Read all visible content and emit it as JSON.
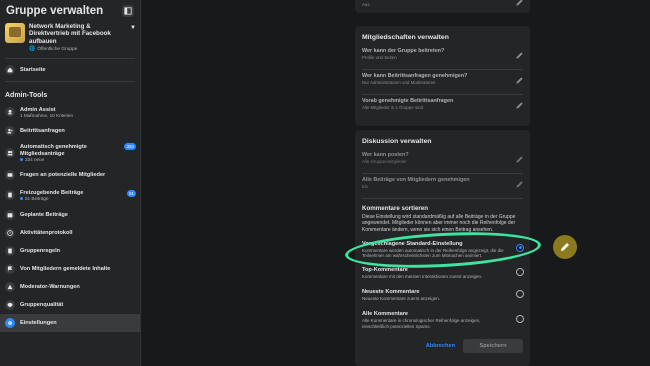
{
  "sidebar": {
    "title": "Gruppe verwalten",
    "group": {
      "name": "Network Marketing & Direktvertrieb mit Facebook aufbauen",
      "type": "Öffentliche Gruppe"
    },
    "home_label": "Startseite",
    "admin_tools_title": "Admin-Tools",
    "items": [
      {
        "label": "Admin Assist",
        "sub": "1 Maßnahme, 10 Kriterien"
      },
      {
        "label": "Beitrittsanfragen",
        "sub": ""
      },
      {
        "label": "Automatisch genehmigte Mitgliedsanträge",
        "sub": "334 neue",
        "badge": "334"
      },
      {
        "label": "Fragen an potenzielle Mitglieder",
        "sub": ""
      },
      {
        "label": "Freizugebende Beiträge",
        "sub": "51 Beiträge",
        "badge": "51"
      },
      {
        "label": "Geplante Beiträge",
        "sub": ""
      },
      {
        "label": "Aktivitätenprotokoll",
        "sub": ""
      },
      {
        "label": "Gruppenregeln",
        "sub": ""
      },
      {
        "label": "Von Mitgliedern gemeldete Inhalte",
        "sub": ""
      },
      {
        "label": "Moderator-Warnungen",
        "sub": ""
      },
      {
        "label": "Gruppenqualität",
        "sub": ""
      },
      {
        "label": "Einstellungen",
        "sub": ""
      }
    ]
  },
  "top_card": {
    "value": "Aus"
  },
  "membership_card": {
    "title": "Mitgliedschaften verwalten",
    "rows": [
      {
        "label": "Wer kann der Gruppe beitreten?",
        "value": "Profile und Seiten"
      },
      {
        "label": "Wer kann Beitrittsanfragen genehmigen?",
        "value": "Nur Administratoren und Moderatoren"
      },
      {
        "label": "Vorab genehmigte Beitrittsanfragen",
        "value": "Alle Mitglieder in 1 Gruppe sind"
      }
    ]
  },
  "discussion_card": {
    "title": "Diskussion verwalten",
    "rows": [
      {
        "label": "Wer kann posten?",
        "value": "Alle Gruppenmitglieder"
      },
      {
        "label": "Alle Beiträge von Mitgliedern genehmigen",
        "value": "Ein"
      }
    ],
    "sort_title": "Kommentare sortieren",
    "sort_desc": "Diese Einstellung wird standardmäßig auf alle Beiträge in der Gruppe angewendet. Mitglieder können aber immer noch die Reihenfolge der Kommentare ändern, wenn sie sich einen Beitrag ansehen.",
    "options": [
      {
        "label": "Vorgeschlagene Standard-Einstellung",
        "desc": "Kommentare werden automatisch in der Reihenfolge angezeigt, die die Teilnehmer am wahrscheinlichsten zum Mitmachen animiert.",
        "checked": true
      },
      {
        "label": "Top-Kommentare",
        "desc": "Kommentare mit den meisten Interaktionen zuerst anzeigen.",
        "checked": false
      },
      {
        "label": "Neueste Kommentare",
        "desc": "Neueste Kommentare zuerst anzeigen.",
        "checked": false
      },
      {
        "label": "Alle Kommentare",
        "desc": "Alle Kommentare in chronologischer Reihenfolge anzeigen, einschließlich potenziellen Spams.",
        "checked": false
      }
    ],
    "cancel_label": "Abbrechen",
    "save_label": "Speichern"
  },
  "colors": {
    "accent": "#2d88ff",
    "annotation": "#3fe3a0"
  }
}
